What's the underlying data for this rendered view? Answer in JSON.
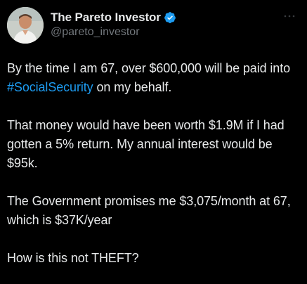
{
  "author": {
    "display_name": "The Pareto Investor",
    "handle": "@pareto_investor",
    "verified": true,
    "verified_color": "#1d9bf0",
    "avatar_icon": "profile-photo"
  },
  "more_icon": "ellipsis-icon",
  "tweet": {
    "p1_before": "By the time I am 67, over $600,000 will be paid into ",
    "p1_hashtag": "#SocialSecurity",
    "p1_after": " on my behalf.",
    "p2": "That money would have been worth $1.9M if I had gotten a 5% return. My annual interest would be $95k.",
    "p3": "The Government promises me $3,075/month at 67, which is $37K/year",
    "p4": "How is this not THEFT?"
  },
  "colors": {
    "background": "#000000",
    "text": "#e7e9ea",
    "secondary_text": "#71767b",
    "link": "#1d9bf0"
  }
}
